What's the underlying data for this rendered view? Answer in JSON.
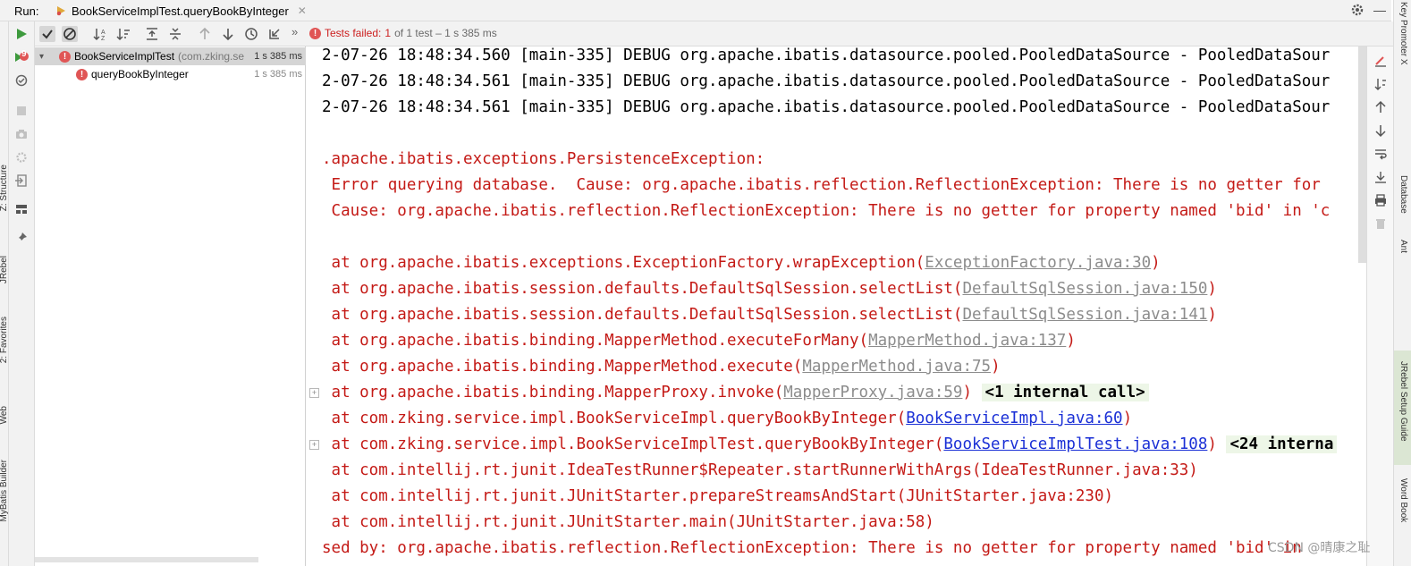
{
  "titlebar": {
    "run_label": "Run:",
    "tab_title": "BookServiceImplTest.queryBookByInteger"
  },
  "left_strip_labels": [
    "Z: Structure",
    "JRebel",
    "2: Favorites",
    "Web",
    "MyBatis Builder"
  ],
  "right_strip_labels": [
    "Key Promoter X",
    "Database",
    "Ant",
    "JRebel Setup Guide",
    "Word Book"
  ],
  "icon_column": {
    "failed_count": "9"
  },
  "status": {
    "tests_failed_label": "Tests failed:",
    "failed_number": "1",
    "detail": "of 1 test – 1 s 385 ms"
  },
  "tree": {
    "items": [
      {
        "name": "BookServiceImplTest",
        "package": "(com.zking.se",
        "time": "1 s 385 ms"
      },
      {
        "name": "queryBookByInteger",
        "package": "",
        "time": "1 s 385 ms"
      }
    ]
  },
  "console": {
    "lines": [
      {
        "text": "2-07-26 18:48:34.560 [main-335] DEBUG org.apache.ibatis.datasource.pooled.PooledDataSource - PooledDataSour",
        "color": "black"
      },
      {
        "text": "2-07-26 18:48:34.561 [main-335] DEBUG org.apache.ibatis.datasource.pooled.PooledDataSource - PooledDataSour",
        "color": "black"
      },
      {
        "text": "2-07-26 18:48:34.561 [main-335] DEBUG org.apache.ibatis.datasource.pooled.PooledDataSource - PooledDataSour",
        "color": "black"
      },
      {
        "text": "",
        "color": "black"
      },
      {
        "text": ".apache.ibatis.exceptions.PersistenceException:",
        "color": "red"
      },
      {
        "text": " Error querying database.  Cause: org.apache.ibatis.reflection.ReflectionException: There is no getter for",
        "color": "red"
      },
      {
        "text": " Cause: org.apache.ibatis.reflection.ReflectionException: There is no getter for property named 'bid' in 'c",
        "color": "red"
      },
      {
        "text": "",
        "color": "red"
      },
      {
        "prefix": " at org.apache.ibatis.exceptions.ExceptionFactory.wrapException(",
        "link": "ExceptionFactory.java:30",
        "suffix": ")",
        "link_color": "gray",
        "color": "red"
      },
      {
        "prefix": " at org.apache.ibatis.session.defaults.DefaultSqlSession.selectList(",
        "link": "DefaultSqlSession.java:150",
        "suffix": ")",
        "link_color": "gray",
        "color": "red"
      },
      {
        "prefix": " at org.apache.ibatis.session.defaults.DefaultSqlSession.selectList(",
        "link": "DefaultSqlSession.java:141",
        "suffix": ")",
        "link_color": "gray",
        "color": "red"
      },
      {
        "prefix": " at org.apache.ibatis.binding.MapperMethod.executeForMany(",
        "link": "MapperMethod.java:137",
        "suffix": ")",
        "link_color": "gray",
        "color": "red"
      },
      {
        "prefix": " at org.apache.ibatis.binding.MapperMethod.execute(",
        "link": "MapperMethod.java:75",
        "suffix": ")",
        "link_color": "gray",
        "color": "red"
      },
      {
        "prefix": " at org.apache.ibatis.binding.MapperProxy.invoke(",
        "link": "MapperProxy.java:59",
        "suffix": ") ",
        "internal": "<1 internal call>",
        "link_color": "gray",
        "color": "red",
        "fold": true
      },
      {
        "prefix": " at com.zking.service.impl.BookServiceImpl.queryBookByInteger(",
        "link": "BookServiceImpl.java:60",
        "suffix": ")",
        "link_color": "blue",
        "color": "red"
      },
      {
        "prefix": " at com.zking.service.impl.BookServiceImplTest.queryBookByInteger(",
        "link": "BookServiceImplTest.java:108",
        "suffix": ") ",
        "internal": "<24 interna",
        "link_color": "blue",
        "color": "red",
        "fold": true
      },
      {
        "text": " at com.intellij.rt.junit.IdeaTestRunner$Repeater.startRunnerWithArgs(IdeaTestRunner.java:33)",
        "color": "red"
      },
      {
        "text": " at com.intellij.rt.junit.JUnitStarter.prepareStreamsAndStart(JUnitStarter.java:230)",
        "color": "red"
      },
      {
        "text": " at com.intellij.rt.junit.JUnitStarter.main(JUnitStarter.java:58)",
        "color": "red"
      },
      {
        "text": "sed by: org.apache.ibatis.reflection.ReflectionException: There is no getter for property named 'bid' in",
        "color": "red"
      }
    ]
  },
  "watermark": "CSDN @晴康之耻",
  "colors": {
    "error_red": "#c41a16",
    "link_gray": "#8c8c8c",
    "link_blue": "#1a2fd6",
    "run_green": "#3d9a3d",
    "fail_badge": "#e05555"
  }
}
